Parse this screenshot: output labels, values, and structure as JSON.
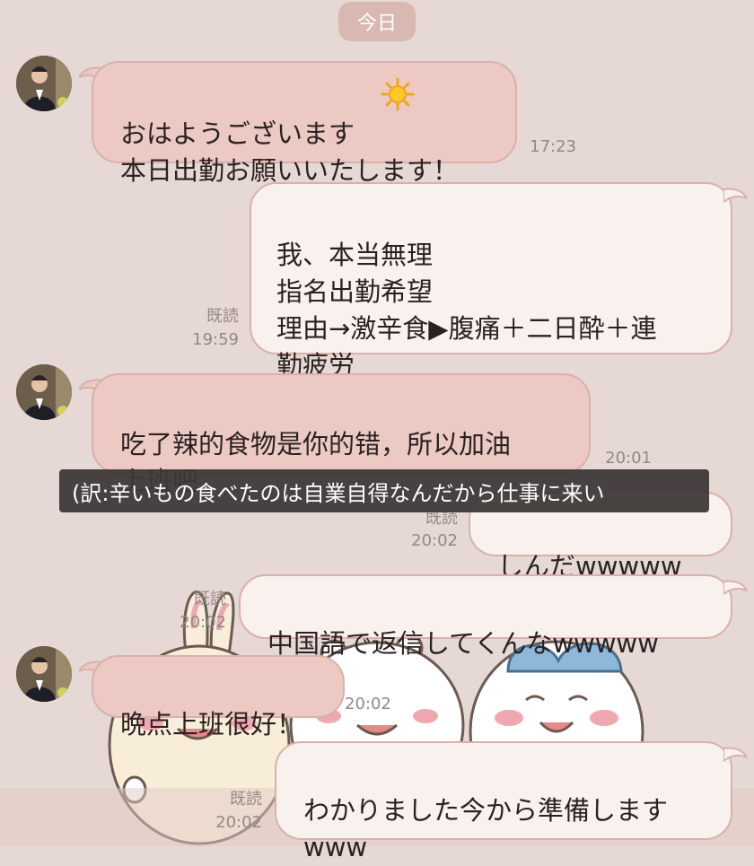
{
  "date_divider": "今日",
  "messages": [
    {
      "text": "おはようございます \n本日出勤お願いいたします！",
      "time": "17:23",
      "read": ""
    },
    {
      "text": "我、本当無理\n指名出勤希望\n理由→激辛食▶腹痛＋二日酔＋連\n勤疲労",
      "time": "19:59",
      "read": "既読"
    },
    {
      "text": "吃了辣的食物是你的错，所以加油\n上班吧",
      "time": "20:01",
      "read": ""
    },
    {
      "text": "しんだwwwww",
      "time": "20:02",
      "read": "既読"
    },
    {
      "text": "中国語で返信してくんなwwwww",
      "time": "20:02",
      "read": "既読"
    },
    {
      "text": "晩点上班很好！",
      "time": "20:02",
      "read": ""
    },
    {
      "text": "わかりました今から準備します\nwww",
      "time": "20:02",
      "read": "既読"
    }
  ],
  "subtitle": "(訳:辛いもの食べたのは自業自得なんだから仕事に来い",
  "icons": [
    "avatar",
    "sun-emoji-icon",
    "bubble-tail-icon",
    "background-characters"
  ],
  "colors": {
    "background": "#e6d8d4",
    "incoming_bubble": "#ecc9c2",
    "outgoing_bubble": "#f9f1ee",
    "bubble_border": "#dab0aa"
  }
}
